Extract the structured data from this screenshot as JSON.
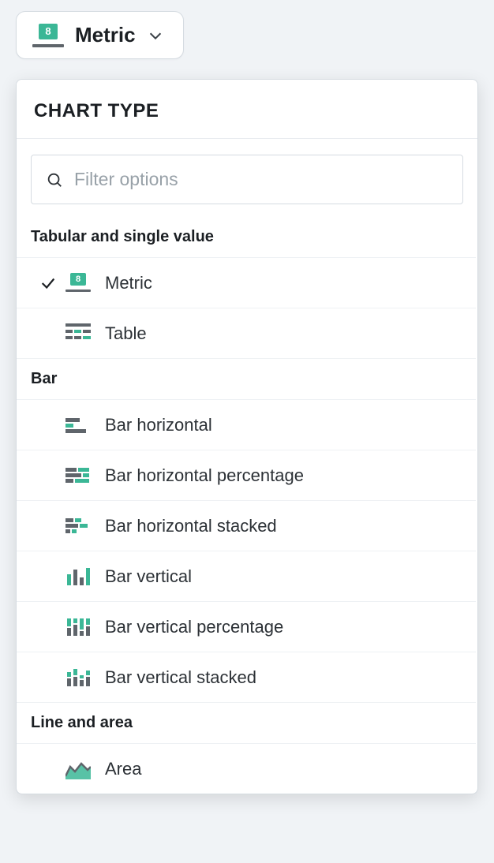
{
  "trigger": {
    "badge_text": "8",
    "label": "Metric"
  },
  "panel": {
    "title": "CHART TYPE",
    "search_placeholder": "Filter options"
  },
  "groups": {
    "tabular": {
      "header": "Tabular and single value",
      "metric": "Metric",
      "metric_badge": "8",
      "table": "Table"
    },
    "bar": {
      "header": "Bar",
      "h": "Bar horizontal",
      "hp": "Bar horizontal percentage",
      "hs": "Bar horizontal stacked",
      "v": "Bar vertical",
      "vp": "Bar vertical percentage",
      "vs": "Bar vertical stacked"
    },
    "line": {
      "header": "Line and area",
      "area": "Area"
    }
  }
}
